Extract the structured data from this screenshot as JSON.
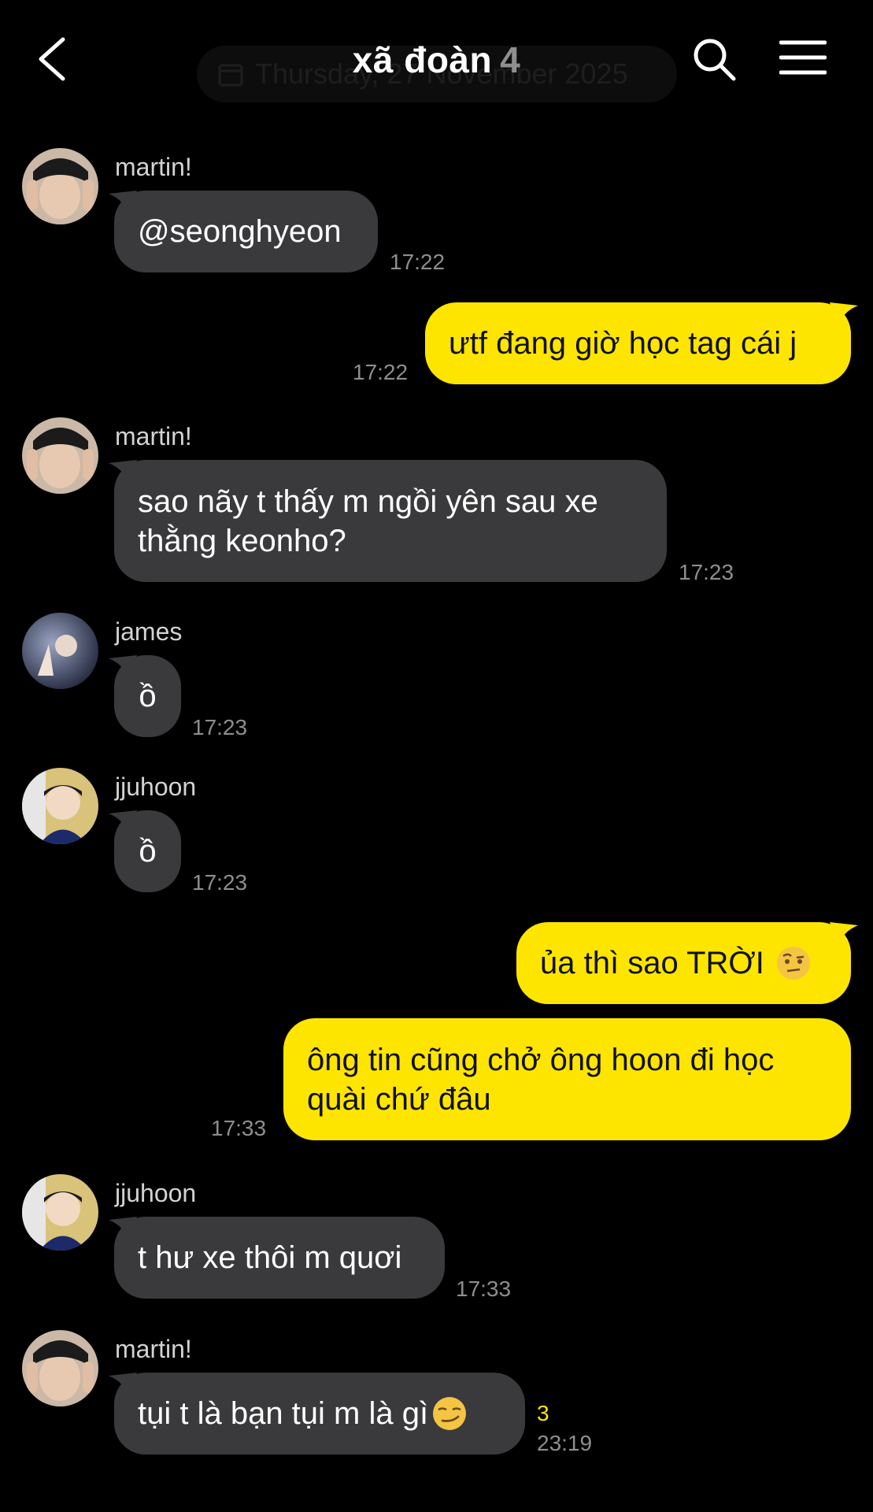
{
  "header": {
    "title": "xã đoàn",
    "member_count": "4",
    "date_pill": "Thursday, 27 November 2025",
    "icons": [
      "back-icon",
      "search-icon",
      "menu-icon"
    ]
  },
  "messages": [
    {
      "sender": "martin!",
      "text": "@seonghyeon",
      "time": "17:22",
      "direction": "in"
    },
    {
      "text": "ưtf đang giờ học tag cái j",
      "time": "17:22",
      "direction": "out"
    },
    {
      "sender": "martin!",
      "text": "sao nãy t thấy m ngồi yên sau xe thằng keonho?",
      "time": "17:23",
      "direction": "in"
    },
    {
      "sender": "james",
      "text": "ồ",
      "time": "17:23",
      "direction": "in"
    },
    {
      "sender": "jjuhoon",
      "text": "ồ",
      "time": "17:23",
      "direction": "in"
    },
    {
      "text": "ủa thì sao TRỜI",
      "emoji": "raised-eyebrow-emoji",
      "direction": "out"
    },
    {
      "text": "ông tin cũng chở ông hoon đi học quài chứ đâu",
      "time": "17:33",
      "direction": "out"
    },
    {
      "sender": "jjuhoon",
      "text": "t hư xe thôi m quơi",
      "time": "17:33",
      "direction": "in"
    },
    {
      "sender": "martin!",
      "text": "tụi t là bạn tụi m là gì",
      "emoji": "smirk-emoji",
      "unread": "3",
      "time": "23:19",
      "direction": "in"
    }
  ],
  "colors": {
    "background": "#000000",
    "incoming_bubble": "#3a3a3c",
    "outgoing_bubble": "#fee500",
    "unread_count": "#fee500",
    "timestamp": "#8e8e8e"
  }
}
